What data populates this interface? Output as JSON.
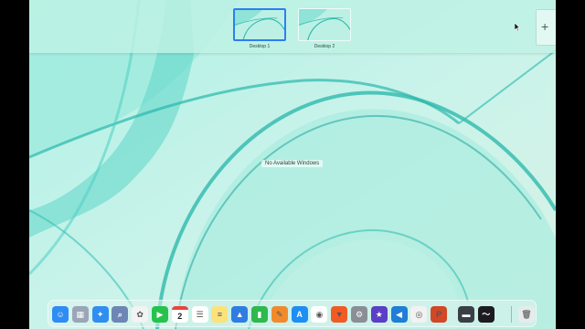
{
  "spaces": [
    {
      "label": "Desktop 1",
      "active": true
    },
    {
      "label": "Desktop 2",
      "active": false
    }
  ],
  "desktop": {
    "message": "No Available Windows"
  },
  "dock": {
    "apps": [
      {
        "name": "finder-icon",
        "color": "#2f8cf2",
        "glyph": "☺"
      },
      {
        "name": "launchpad-icon",
        "color": "#9aa6b8",
        "glyph": "▦"
      },
      {
        "name": "safari-icon",
        "color": "#2f8ff0",
        "glyph": "✦"
      },
      {
        "name": "preview-icon",
        "color": "#6d86b5",
        "glyph": "⌕"
      },
      {
        "name": "photos-icon",
        "color": "#f3f3f3",
        "glyph": "✿"
      },
      {
        "name": "facetime-icon",
        "color": "#27c24c",
        "glyph": "▶"
      },
      {
        "name": "calendar-icon",
        "color": "#ffffff",
        "glyph": "2"
      },
      {
        "name": "reminders-icon",
        "color": "#ffffff",
        "glyph": "☰"
      },
      {
        "name": "notes-icon",
        "color": "#fbe27a",
        "glyph": "≡"
      },
      {
        "name": "keynote-icon",
        "color": "#2f7de1",
        "glyph": "▲"
      },
      {
        "name": "numbers-icon",
        "color": "#2fb84e",
        "glyph": "▮"
      },
      {
        "name": "pages-icon",
        "color": "#f08b2c",
        "glyph": "✎"
      },
      {
        "name": "app-store-icon",
        "color": "#1e8ef5",
        "glyph": "A"
      },
      {
        "name": "chrome-icon",
        "color": "#ffffff",
        "glyph": "◉"
      },
      {
        "name": "brave-icon",
        "color": "#f25a24",
        "glyph": "▼"
      },
      {
        "name": "system-settings-icon",
        "color": "#8a8f96",
        "glyph": "⚙"
      },
      {
        "name": "imovie-icon",
        "color": "#5b3fc4",
        "glyph": "★"
      },
      {
        "name": "vscode-icon",
        "color": "#1f7ed6",
        "glyph": "◀"
      },
      {
        "name": "blender-icon",
        "color": "#f2f2f2",
        "glyph": "◎"
      },
      {
        "name": "powerpoint-icon",
        "color": "#d24726",
        "glyph": "P"
      },
      {
        "name": "screen-recorder-icon",
        "color": "#3a3f46",
        "glyph": "▬"
      },
      {
        "name": "voice-memos-icon",
        "color": "#1c1c1e",
        "glyph": "〜"
      }
    ],
    "trash": {
      "name": "trash-icon",
      "color": "#e6ecec",
      "glyph": "🗑"
    }
  },
  "colors": {
    "accent": "#2d7ff0",
    "wallpaper_light": "#cdeee0",
    "wallpaper_mid": "#5fd9cd",
    "wallpaper_dark": "#1fa59a"
  }
}
